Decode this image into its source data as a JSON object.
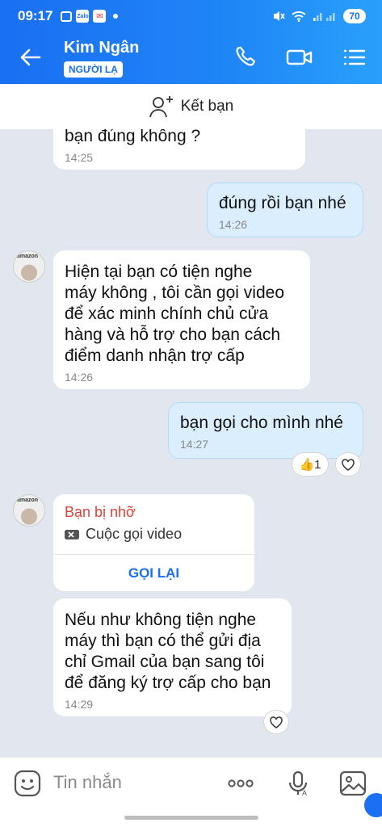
{
  "status": {
    "time": "09:17",
    "battery": "70",
    "zalo_mark": "Zalo"
  },
  "header": {
    "contact_name": "Kim Ngân",
    "tag": "NGƯỜI LẠ"
  },
  "add_friend": {
    "label": "Kết bạn"
  },
  "messages": [
    {
      "from": "them",
      "text": "bạn  đúng không ?",
      "time": "14:25"
    },
    {
      "from": "me",
      "text": "đúng rồi bạn nhé",
      "time": "14:26"
    },
    {
      "from": "them",
      "lines": [
        "Hiện tại bạn có tiện nghe",
        "máy không , tôi cần gọi video",
        "để xác minh chính chủ cửa",
        "hàng và hỗ trợ cho bạn cách",
        "điểm danh nhận trợ cấp"
      ],
      "time": "14:26"
    },
    {
      "from": "me",
      "text": "bạn gọi cho mình nhé",
      "time": "14:27",
      "reaction_count": "1"
    },
    {
      "from": "them",
      "lines": [
        "Nếu như không tiện nghe",
        "máy thì bạn có thể gửi địa",
        "chỉ Gmail của bạn sang tôi",
        "để đăng ký trợ cấp cho bạn"
      ],
      "time": "14:29"
    }
  ],
  "call": {
    "status": "Bạn bị nhỡ",
    "type": "Cuộc gọi video",
    "action": "GỌI LẠI"
  },
  "avatar_label": "amazon",
  "input": {
    "placeholder": "Tin nhắn"
  },
  "colors": {
    "header_blue": "#1a6ff2",
    "my_bubble": "#daeefe",
    "missed_red": "#e0413a",
    "chat_bg": "#e2e7ef"
  }
}
